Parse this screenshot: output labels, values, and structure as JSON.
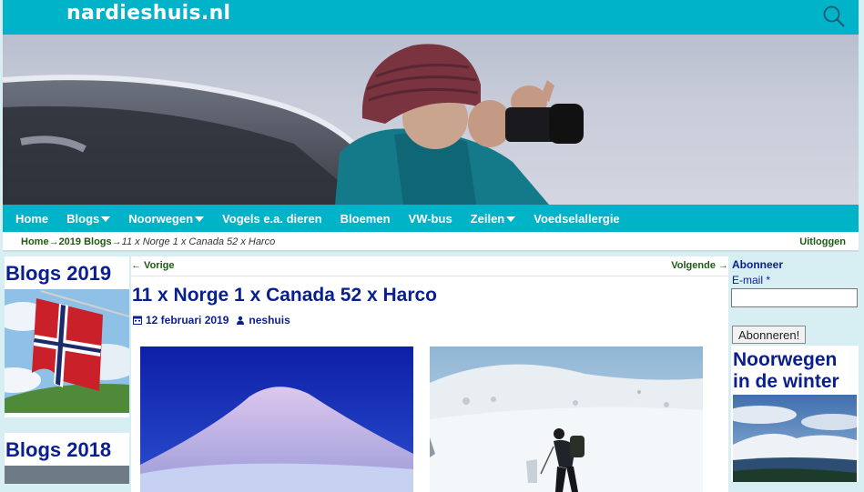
{
  "header": {
    "site_title": "nardieshuis.nl",
    "search_icon": "search-icon"
  },
  "nav": {
    "items": [
      {
        "label": "Home",
        "dropdown": false
      },
      {
        "label": "Blogs",
        "dropdown": true
      },
      {
        "label": "Noorwegen",
        "dropdown": true
      },
      {
        "label": "Vogels e.a. dieren",
        "dropdown": false
      },
      {
        "label": "Bloemen",
        "dropdown": false
      },
      {
        "label": "VW-bus",
        "dropdown": false
      },
      {
        "label": "Zeilen",
        "dropdown": true
      },
      {
        "label": "Voedselallergie",
        "dropdown": false
      }
    ]
  },
  "breadcrumb": {
    "home": "Home",
    "sep": "→",
    "section": "2019 Blogs",
    "current": "11 x Norge 1 x Canada 52 x Harco",
    "logout": "Uitloggen"
  },
  "left_sidebar": {
    "box1_title": "Blogs 2019",
    "box2_title": "Blogs 2018"
  },
  "post": {
    "prev_label": "← Vorige",
    "next_label": "Volgende →",
    "title": "11 x Norge 1 x Canada 52 x Harco",
    "date": "12 februari 2019",
    "author": "neshuis"
  },
  "right_sidebar": {
    "subscribe_title": "Abonneer",
    "email_label": "E-mail *",
    "email_value": "",
    "subscribe_button": "Abonneren!",
    "box_title": "Noorwegen in de winter"
  },
  "colors": {
    "accent": "#00b3c8",
    "heading": "#0a1f8f",
    "link": "#1f5a12",
    "page_bg": "#d7eef3"
  }
}
